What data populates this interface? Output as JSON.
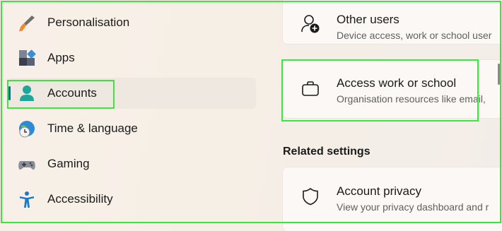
{
  "sidebar": {
    "items": [
      {
        "label": "Personalisation",
        "icon": "brush-icon"
      },
      {
        "label": "Apps",
        "icon": "apps-icon"
      },
      {
        "label": "Accounts",
        "icon": "person-icon",
        "selected": true
      },
      {
        "label": "Time & language",
        "icon": "globe-clock-icon"
      },
      {
        "label": "Gaming",
        "icon": "gamepad-icon"
      },
      {
        "label": "Accessibility",
        "icon": "accessibility-icon"
      }
    ]
  },
  "main": {
    "cards": [
      {
        "title": "Other users",
        "subtitle": "Device access, work or school user",
        "icon": "add-user-icon"
      },
      {
        "title": "Access work or school",
        "subtitle": "Organisation resources like email,",
        "icon": "briefcase-icon"
      }
    ],
    "related_settings": {
      "title": "Related settings",
      "items": [
        {
          "title": "Account privacy",
          "subtitle": "View your privacy dashboard and r",
          "icon": "shield-icon"
        }
      ]
    }
  },
  "colors": {
    "highlight": "#39e63a",
    "accent": "#1d6a8d"
  }
}
